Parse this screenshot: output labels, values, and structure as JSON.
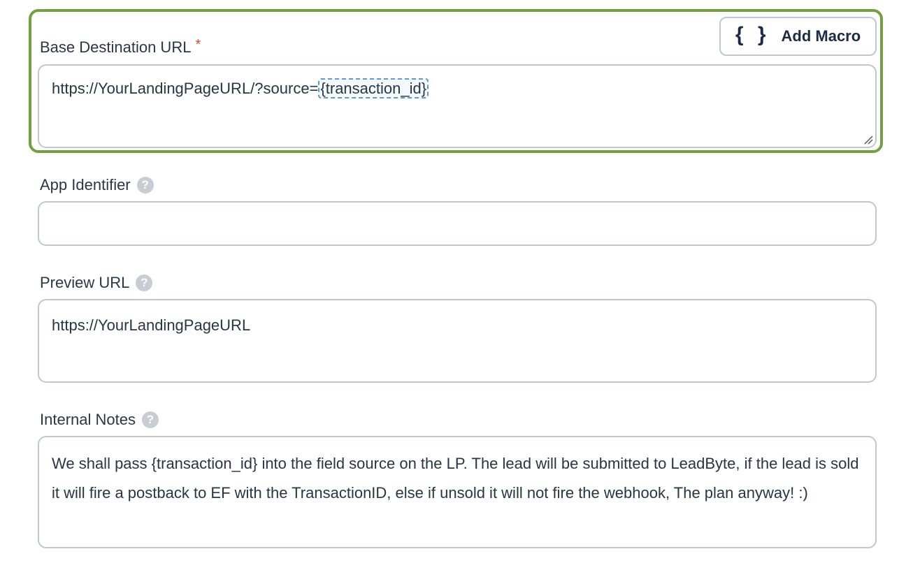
{
  "base_destination": {
    "label": "Base Destination URL",
    "required_marker": "*",
    "value_prefix": "https://YourLandingPageURL/?source=",
    "macro_token": "{transaction_id}",
    "add_macro_label": "Add Macro",
    "add_macro_icon": "{ }"
  },
  "app_identifier": {
    "label": "App Identifier",
    "help_icon": "?",
    "value": ""
  },
  "preview_url": {
    "label": "Preview URL",
    "help_icon": "?",
    "value": "https://YourLandingPageURL"
  },
  "internal_notes": {
    "label": "Internal Notes",
    "help_icon": "?",
    "value": "We shall pass {transaction_id} into the field source on the LP.  The lead will be submitted to LeadByte, if the lead is sold it will fire a postback to EF with the TransactionID, else if unsold it will not fire the webhook,  The plan anyway! :)"
  },
  "colors": {
    "highlight_border": "#72a040",
    "field_border": "#c2c7ce",
    "required": "#e0483a",
    "macro_token_border": "#5b9bd5"
  }
}
